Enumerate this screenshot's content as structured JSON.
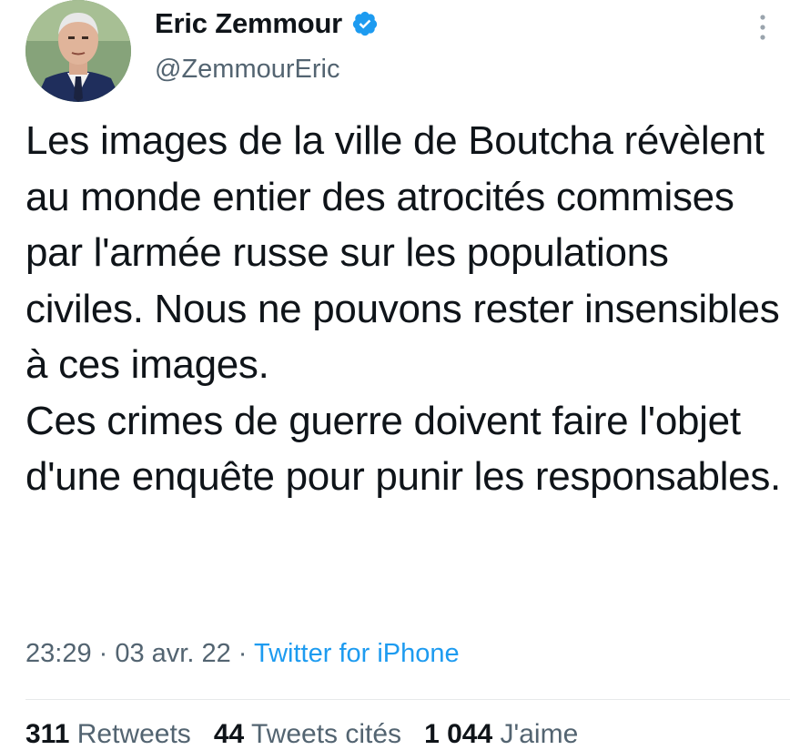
{
  "author": {
    "name": "Eric Zemmour",
    "handle": "@ZemmourEric",
    "verified": true
  },
  "tweet": {
    "paragraphs": [
      "Les images de la ville de Boutcha révèlent au monde entier des atrocités commises par l'armée russe sur les populations civiles. Nous ne pouvons rester insensibles à ces images.",
      "Ces crimes de guerre doivent faire l'objet d'une enquête pour punir les responsables."
    ]
  },
  "meta": {
    "time": "23:29",
    "separator": " · ",
    "date": "03 avr. 22",
    "source": "Twitter for iPhone"
  },
  "stats": {
    "retweets_count": "311",
    "retweets_label": "Retweets",
    "quotes_count": "44",
    "quotes_label": "Tweets cités",
    "likes_count": "1 044",
    "likes_label": "J'aime"
  },
  "colors": {
    "text": "#0f1419",
    "secondary": "#536471",
    "link": "#1d9bf0",
    "verified": "#1d9bf0"
  },
  "icons": {
    "verified": "verified-badge-icon",
    "more": "more-vertical-icon"
  }
}
